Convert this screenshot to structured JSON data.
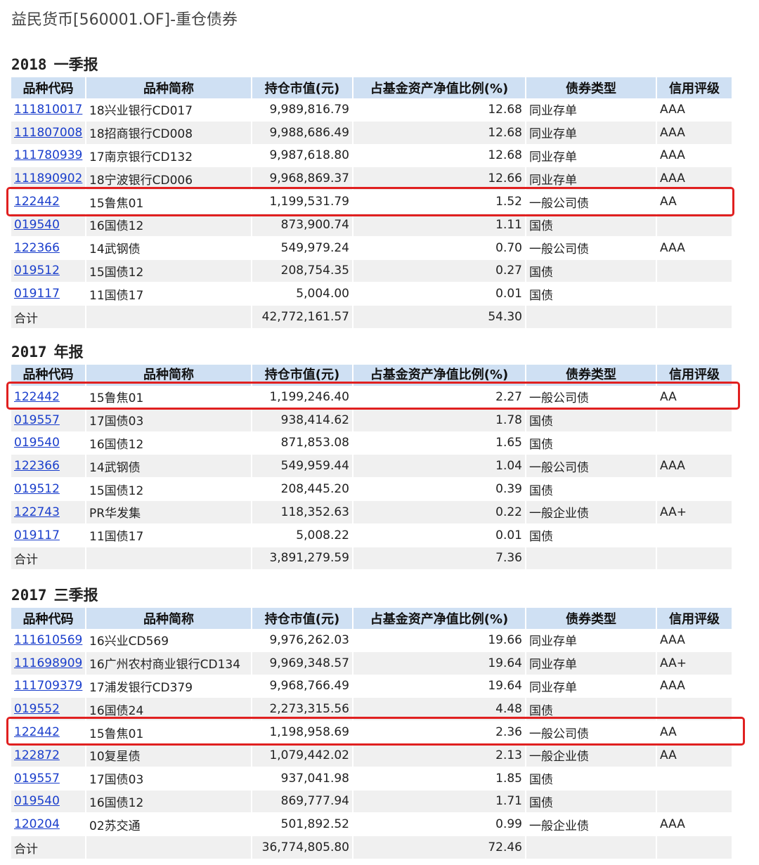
{
  "page": {
    "title": "益民货币[560001.OF]-重仓债券"
  },
  "columns": [
    "品种代码",
    "品种简称",
    "持仓市值(元)",
    "占基金资产净值比例(%)",
    "债券类型",
    "信用评级"
  ],
  "sections": [
    {
      "year": "2018",
      "period": "一季报",
      "rows": [
        [
          "111810017",
          "18兴业银行CD017",
          "9,989,816.79",
          "12.68",
          "同业存单",
          "AAA"
        ],
        [
          "111807008",
          "18招商银行CD008",
          "9,988,686.49",
          "12.68",
          "同业存单",
          "AAA"
        ],
        [
          "111780939",
          "17南京银行CD132",
          "9,987,618.80",
          "12.68",
          "同业存单",
          "AAA"
        ],
        [
          "111890902",
          "18宁波银行CD006",
          "9,968,869.37",
          "12.66",
          "同业存单",
          "AAA"
        ],
        [
          "122442",
          "15鲁焦01",
          "1,199,531.79",
          "1.52",
          "一般公司债",
          "AA"
        ],
        [
          "019540",
          "16国债12",
          "873,900.74",
          "1.11",
          "国债",
          ""
        ],
        [
          "122366",
          "14武钢债",
          "549,979.24",
          "0.70",
          "一般公司债",
          "AAA"
        ],
        [
          "019512",
          "15国债12",
          "208,754.35",
          "0.27",
          "国债",
          ""
        ],
        [
          "019117",
          "11国债17",
          "5,004.00",
          "0.01",
          "国债",
          ""
        ]
      ],
      "total": [
        "合计",
        "",
        "42,772,161.57",
        "54.30",
        "",
        ""
      ]
    },
    {
      "year": "2017",
      "period": "年报",
      "rows": [
        [
          "122442",
          "15鲁焦01",
          "1,199,246.40",
          "2.27",
          "一般公司债",
          "AA"
        ],
        [
          "019557",
          "17国债03",
          "938,414.62",
          "1.78",
          "国债",
          ""
        ],
        [
          "019540",
          "16国债12",
          "871,853.08",
          "1.65",
          "国债",
          ""
        ],
        [
          "122366",
          "14武钢债",
          "549,959.44",
          "1.04",
          "一般公司债",
          "AAA"
        ],
        [
          "019512",
          "15国债12",
          "208,445.20",
          "0.39",
          "国债",
          ""
        ],
        [
          "122743",
          "PR华发集",
          "118,352.63",
          "0.22",
          "一般企业债",
          "AA+"
        ],
        [
          "019117",
          "11国债17",
          "5,008.22",
          "0.01",
          "国债",
          ""
        ]
      ],
      "total": [
        "合计",
        "",
        "3,891,279.59",
        "7.36",
        "",
        ""
      ]
    },
    {
      "year": "2017",
      "period": "三季报",
      "rows": [
        [
          "111610569",
          "16兴业CD569",
          "9,976,262.03",
          "19.66",
          "同业存单",
          "AAA"
        ],
        [
          "111698909",
          "16广州农村商业银行CD134",
          "9,969,348.57",
          "19.64",
          "同业存单",
          "AA+"
        ],
        [
          "111709379",
          "17浦发银行CD379",
          "9,968,766.49",
          "19.64",
          "同业存单",
          "AAA"
        ],
        [
          "019552",
          "16国债24",
          "2,273,315.56",
          "4.48",
          "国债",
          ""
        ],
        [
          "122442",
          "15鲁焦01",
          "1,198,958.69",
          "2.36",
          "一般公司债",
          "AA"
        ],
        [
          "122872",
          "10复星债",
          "1,079,442.02",
          "2.13",
          "一般企业债",
          "AA"
        ],
        [
          "019557",
          "17国债03",
          "937,041.98",
          "1.85",
          "国债",
          ""
        ],
        [
          "019540",
          "16国债12",
          "869,777.94",
          "1.71",
          "国债",
          ""
        ],
        [
          "120204",
          "02苏交通",
          "501,892.52",
          "0.99",
          "一般企业债",
          "AAA"
        ]
      ],
      "total": [
        "合计",
        "",
        "36,774,805.80",
        "72.46",
        "",
        ""
      ]
    }
  ],
  "highlight_color": "#e02020",
  "header_bg": "#cfe0f3",
  "link_color": "#1a3ecc"
}
